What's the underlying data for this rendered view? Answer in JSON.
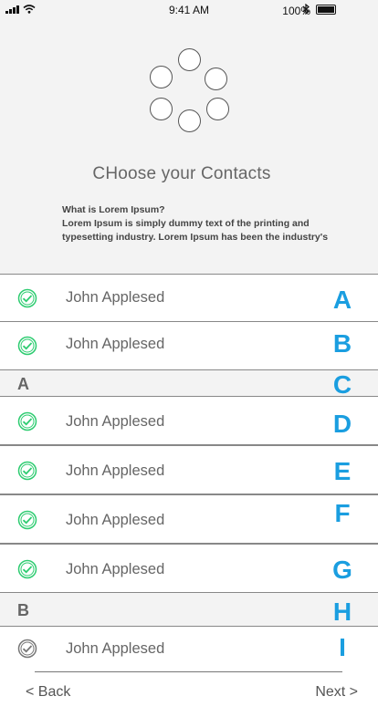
{
  "status_bar": {
    "time": "9:41 AM",
    "battery": "100%"
  },
  "title": "CHoose your Contacts",
  "description": {
    "heading": "What is Lorem Ipsum?",
    "line1": "Lorem Ipsum is simply dummy text of the printing and",
    "line2": "typesetting industry. Lorem Ipsum has been the industry's"
  },
  "sections": {
    "a": "A",
    "b": "B"
  },
  "contacts": [
    {
      "name": "John Applesed",
      "selected": true
    },
    {
      "name": "John Applesed",
      "selected": true
    },
    {
      "name": "John Applesed",
      "selected": true
    },
    {
      "name": "John Applesed",
      "selected": true
    },
    {
      "name": "John Applesed",
      "selected": true
    },
    {
      "name": "John Applesed",
      "selected": true
    },
    {
      "name": "John Applesed",
      "selected": false
    }
  ],
  "index_letters": [
    "A",
    "B",
    "C",
    "D",
    "E",
    "F",
    "G",
    "H",
    "I"
  ],
  "nav": {
    "back": "< Back",
    "next": "Next >"
  },
  "colors": {
    "accent": "#1a9ee0",
    "check_green": "#2ecc71",
    "check_gray": "#777777"
  }
}
